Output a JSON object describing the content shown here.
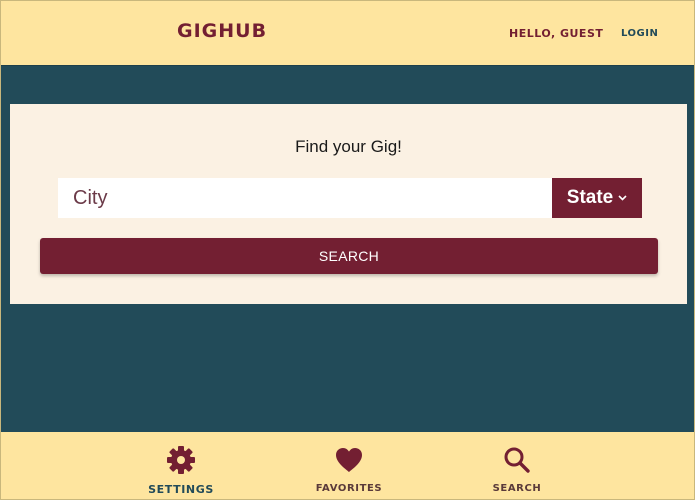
{
  "header": {
    "brand": "GIGHUB",
    "greeting": "HELLO, GUEST",
    "login_label": "LOGIN"
  },
  "search_card": {
    "title": "Find your Gig!",
    "city_placeholder": "City",
    "state_label": "State",
    "search_label": "SEARCH"
  },
  "bottom_nav": {
    "items": [
      {
        "label": "SETTINGS",
        "icon": "gear-icon"
      },
      {
        "label": "FAVORITES",
        "icon": "heart-icon"
      },
      {
        "label": "SEARCH",
        "icon": "magnifier-icon"
      }
    ]
  },
  "colors": {
    "header_bg": "#fee59f",
    "page_bg": "#224b59",
    "card_bg": "#fbf1e3",
    "accent": "#731f32"
  }
}
